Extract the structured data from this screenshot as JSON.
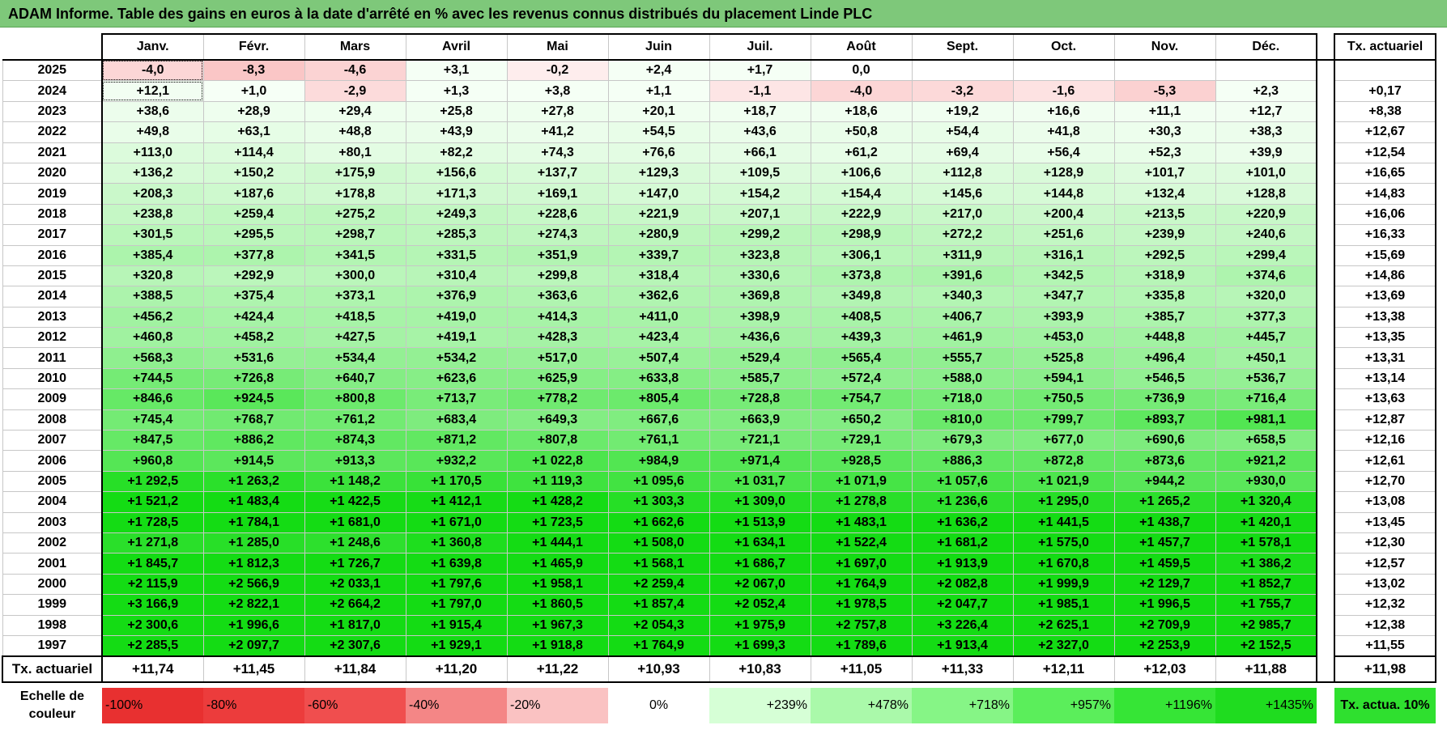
{
  "title": "ADAM Informe. Table des gains en euros à la date d'arrêté en % avec les revenus connus distribués du placement Linde PLC",
  "chart_data": {
    "type": "table",
    "title": "ADAM Informe. Table des gains en euros à la date d'arrêté en % avec les revenus connus distribués du placement Linde PLC",
    "columns": [
      "Janv.",
      "Févr.",
      "Mars",
      "Avril",
      "Mai",
      "Juin",
      "Juil.",
      "Août",
      "Sept.",
      "Oct.",
      "Nov.",
      "Déc."
    ],
    "actuarial_header": "Tx. actuariel",
    "rows": [
      {
        "year": "2025",
        "values": [
          "-4,0",
          "-8,3",
          "-4,6",
          "+3,1",
          "-0,2",
          "+2,4",
          "+1,7",
          "0,0",
          "",
          "",
          "",
          ""
        ],
        "actu": ""
      },
      {
        "year": "2024",
        "values": [
          "+12,1",
          "+1,0",
          "-2,9",
          "+1,3",
          "+3,8",
          "+1,1",
          "-1,1",
          "-4,0",
          "-3,2",
          "-1,6",
          "-5,3",
          "+2,3"
        ],
        "actu": "+0,17"
      },
      {
        "year": "2023",
        "values": [
          "+38,6",
          "+28,9",
          "+29,4",
          "+25,8",
          "+27,8",
          "+20,1",
          "+18,7",
          "+18,6",
          "+19,2",
          "+16,6",
          "+11,1",
          "+12,7"
        ],
        "actu": "+8,38"
      },
      {
        "year": "2022",
        "values": [
          "+49,8",
          "+63,1",
          "+48,8",
          "+43,9",
          "+41,2",
          "+54,5",
          "+43,6",
          "+50,8",
          "+54,4",
          "+41,8",
          "+30,3",
          "+38,3"
        ],
        "actu": "+12,67"
      },
      {
        "year": "2021",
        "values": [
          "+113,0",
          "+114,4",
          "+80,1",
          "+82,2",
          "+74,3",
          "+76,6",
          "+66,1",
          "+61,2",
          "+69,4",
          "+56,4",
          "+52,3",
          "+39,9"
        ],
        "actu": "+12,54"
      },
      {
        "year": "2020",
        "values": [
          "+136,2",
          "+150,2",
          "+175,9",
          "+156,6",
          "+137,7",
          "+129,3",
          "+109,5",
          "+106,6",
          "+112,8",
          "+128,9",
          "+101,7",
          "+101,0"
        ],
        "actu": "+16,65"
      },
      {
        "year": "2019",
        "values": [
          "+208,3",
          "+187,6",
          "+178,8",
          "+171,3",
          "+169,1",
          "+147,0",
          "+154,2",
          "+154,4",
          "+145,6",
          "+144,8",
          "+132,4",
          "+128,8"
        ],
        "actu": "+14,83"
      },
      {
        "year": "2018",
        "values": [
          "+238,8",
          "+259,4",
          "+275,2",
          "+249,3",
          "+228,6",
          "+221,9",
          "+207,1",
          "+222,9",
          "+217,0",
          "+200,4",
          "+213,5",
          "+220,9"
        ],
        "actu": "+16,06"
      },
      {
        "year": "2017",
        "values": [
          "+301,5",
          "+295,5",
          "+298,7",
          "+285,3",
          "+274,3",
          "+280,9",
          "+299,2",
          "+298,9",
          "+272,2",
          "+251,6",
          "+239,9",
          "+240,6"
        ],
        "actu": "+16,33"
      },
      {
        "year": "2016",
        "values": [
          "+385,4",
          "+377,8",
          "+341,5",
          "+331,5",
          "+351,9",
          "+339,7",
          "+323,8",
          "+306,1",
          "+311,9",
          "+316,1",
          "+292,5",
          "+299,4"
        ],
        "actu": "+15,69"
      },
      {
        "year": "2015",
        "values": [
          "+320,8",
          "+292,9",
          "+300,0",
          "+310,4",
          "+299,8",
          "+318,4",
          "+330,6",
          "+373,8",
          "+391,6",
          "+342,5",
          "+318,9",
          "+374,6"
        ],
        "actu": "+14,86"
      },
      {
        "year": "2014",
        "values": [
          "+388,5",
          "+375,4",
          "+373,1",
          "+376,9",
          "+363,6",
          "+362,6",
          "+369,8",
          "+349,8",
          "+340,3",
          "+347,7",
          "+335,8",
          "+320,0"
        ],
        "actu": "+13,69"
      },
      {
        "year": "2013",
        "values": [
          "+456,2",
          "+424,4",
          "+418,5",
          "+419,0",
          "+414,3",
          "+411,0",
          "+398,9",
          "+408,5",
          "+406,7",
          "+393,9",
          "+385,7",
          "+377,3"
        ],
        "actu": "+13,38"
      },
      {
        "year": "2012",
        "values": [
          "+460,8",
          "+458,2",
          "+427,5",
          "+419,1",
          "+428,3",
          "+423,4",
          "+436,6",
          "+439,3",
          "+461,9",
          "+453,0",
          "+448,8",
          "+445,7"
        ],
        "actu": "+13,35"
      },
      {
        "year": "2011",
        "values": [
          "+568,3",
          "+531,6",
          "+534,4",
          "+534,2",
          "+517,0",
          "+507,4",
          "+529,4",
          "+565,4",
          "+555,7",
          "+525,8",
          "+496,4",
          "+450,1"
        ],
        "actu": "+13,31"
      },
      {
        "year": "2010",
        "values": [
          "+744,5",
          "+726,8",
          "+640,7",
          "+623,6",
          "+625,9",
          "+633,8",
          "+585,7",
          "+572,4",
          "+588,0",
          "+594,1",
          "+546,5",
          "+536,7"
        ],
        "actu": "+13,14"
      },
      {
        "year": "2009",
        "values": [
          "+846,6",
          "+924,5",
          "+800,8",
          "+713,7",
          "+778,2",
          "+805,4",
          "+728,8",
          "+754,7",
          "+718,0",
          "+750,5",
          "+736,9",
          "+716,4"
        ],
        "actu": "+13,63"
      },
      {
        "year": "2008",
        "values": [
          "+745,4",
          "+768,7",
          "+761,2",
          "+683,4",
          "+649,3",
          "+667,6",
          "+663,9",
          "+650,2",
          "+810,0",
          "+799,7",
          "+893,7",
          "+981,1"
        ],
        "actu": "+12,87"
      },
      {
        "year": "2007",
        "values": [
          "+847,5",
          "+886,2",
          "+874,3",
          "+871,2",
          "+807,8",
          "+761,1",
          "+721,1",
          "+729,1",
          "+679,3",
          "+677,0",
          "+690,6",
          "+658,5"
        ],
        "actu": "+12,16"
      },
      {
        "year": "2006",
        "values": [
          "+960,8",
          "+914,5",
          "+913,3",
          "+932,2",
          "+1 022,8",
          "+984,9",
          "+971,4",
          "+928,5",
          "+886,3",
          "+872,8",
          "+873,6",
          "+921,2"
        ],
        "actu": "+12,61"
      },
      {
        "year": "2005",
        "values": [
          "+1 292,5",
          "+1 263,2",
          "+1 148,2",
          "+1 170,5",
          "+1 119,3",
          "+1 095,6",
          "+1 031,7",
          "+1 071,9",
          "+1 057,6",
          "+1 021,9",
          "+944,2",
          "+930,0"
        ],
        "actu": "+12,70"
      },
      {
        "year": "2004",
        "values": [
          "+1 521,2",
          "+1 483,4",
          "+1 422,5",
          "+1 412,1",
          "+1 428,2",
          "+1 303,3",
          "+1 309,0",
          "+1 278,8",
          "+1 236,6",
          "+1 295,0",
          "+1 265,2",
          "+1 320,4"
        ],
        "actu": "+13,08"
      },
      {
        "year": "2003",
        "values": [
          "+1 728,5",
          "+1 784,1",
          "+1 681,0",
          "+1 671,0",
          "+1 723,5",
          "+1 662,6",
          "+1 513,9",
          "+1 483,1",
          "+1 636,2",
          "+1 441,5",
          "+1 438,7",
          "+1 420,1"
        ],
        "actu": "+13,45"
      },
      {
        "year": "2002",
        "values": [
          "+1 271,8",
          "+1 285,0",
          "+1 248,6",
          "+1 360,8",
          "+1 444,1",
          "+1 508,0",
          "+1 634,1",
          "+1 522,4",
          "+1 681,2",
          "+1 575,0",
          "+1 457,7",
          "+1 578,1"
        ],
        "actu": "+12,30"
      },
      {
        "year": "2001",
        "values": [
          "+1 845,7",
          "+1 812,3",
          "+1 726,7",
          "+1 639,8",
          "+1 465,9",
          "+1 568,1",
          "+1 686,7",
          "+1 697,0",
          "+1 913,9",
          "+1 670,8",
          "+1 459,5",
          "+1 386,2"
        ],
        "actu": "+12,57"
      },
      {
        "year": "2000",
        "values": [
          "+2 115,9",
          "+2 566,9",
          "+2 033,1",
          "+1 797,6",
          "+1 958,1",
          "+2 259,4",
          "+2 067,0",
          "+1 764,9",
          "+2 082,8",
          "+1 999,9",
          "+2 129,7",
          "+1 852,7"
        ],
        "actu": "+13,02"
      },
      {
        "year": "1999",
        "values": [
          "+3 166,9",
          "+2 822,1",
          "+2 664,2",
          "+1 797,0",
          "+1 860,5",
          "+1 857,4",
          "+2 052,4",
          "+1 978,5",
          "+2 047,7",
          "+1 985,1",
          "+1 996,5",
          "+1 755,7"
        ],
        "actu": "+12,32"
      },
      {
        "year": "1998",
        "values": [
          "+2 300,6",
          "+1 996,6",
          "+1 817,0",
          "+1 915,4",
          "+1 967,3",
          "+2 054,3",
          "+1 975,9",
          "+2 757,8",
          "+3 226,4",
          "+2 625,1",
          "+2 709,9",
          "+2 985,7"
        ],
        "actu": "+12,38"
      },
      {
        "year": "1997",
        "values": [
          "+2 285,5",
          "+2 097,7",
          "+2 307,6",
          "+1 929,1",
          "+1 918,8",
          "+1 764,9",
          "+1 699,3",
          "+1 789,6",
          "+1 913,4",
          "+2 327,0",
          "+2 253,9",
          "+2 152,5"
        ],
        "actu": "+11,55"
      }
    ],
    "footer": {
      "label": "Tx. actuariel",
      "values": [
        "+11,74",
        "+11,45",
        "+11,84",
        "+11,20",
        "+11,22",
        "+10,93",
        "+10,83",
        "+11,05",
        "+11,33",
        "+12,11",
        "+12,03",
        "+11,88"
      ],
      "overall": "+11,98"
    },
    "color_scale": {
      "label": "Echelle de couleur",
      "stops": [
        {
          "text": "-100%",
          "color": "#e83030"
        },
        {
          "text": "-80%",
          "color": "#ec3c3c"
        },
        {
          "text": "-60%",
          "color": "#f04e4e"
        },
        {
          "text": "-40%",
          "color": "#f48686"
        },
        {
          "text": "-20%",
          "color": "#fac2c2"
        },
        {
          "text": "0%",
          "color": "#ffffff"
        },
        {
          "text": "+239%",
          "color": "#d6ffd6"
        },
        {
          "text": "+478%",
          "color": "#aaf9aa"
        },
        {
          "text": "+718%",
          "color": "#86f586"
        },
        {
          "text": "+957%",
          "color": "#5bee5b"
        },
        {
          "text": "+1196%",
          "color": "#36e536"
        },
        {
          "text": "+1435%",
          "color": "#1fdc1f"
        }
      ],
      "actua_label": "Tx. actua. 10%",
      "actua_color": "#2fe02f"
    }
  }
}
